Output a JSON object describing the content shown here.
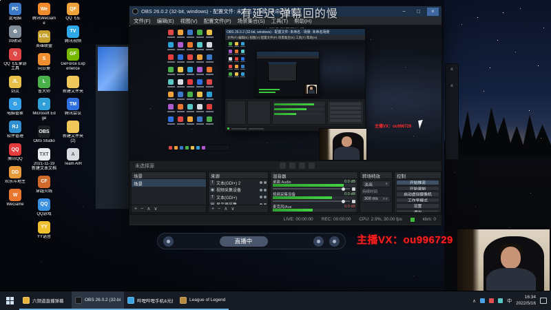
{
  "overlay": {
    "top_text": "有延迟 弹幕回的慢",
    "vx_text": "主播VX：ou996729",
    "pill_label": "直播中"
  },
  "desktop": {
    "columns": [
      [
        {
          "label": "此电脑",
          "glyph": "PC",
          "bg": "#3b78c8"
        },
        {
          "label": "回收站",
          "glyph": "♻",
          "bg": "#7f8c99"
        },
        {
          "label": "QQ飞车掌游工具",
          "glyph": "Q",
          "bg": "#e04848"
        },
        {
          "label": "剑灵",
          "glyph": "JL",
          "bg": "#e8c04a"
        },
        {
          "label": "电脑管家",
          "glyph": "G",
          "bg": "#35a0e8"
        },
        {
          "label": "软件管理",
          "glyph": "RJ",
          "bg": "#2f8fd0"
        },
        {
          "label": "腾讯QQ",
          "glyph": "QQ",
          "bg": "#e43c3c"
        },
        {
          "label": "欢乐斗地主",
          "glyph": "DD",
          "bg": "#e89a3a"
        },
        {
          "label": "WeGame",
          "glyph": "W",
          "bg": "#e8762e"
        }
      ],
      [
        {
          "label": "腾讯WeGame",
          "glyph": "We",
          "bg": "#f08a2a"
        },
        {
          "label": "英雄联盟",
          "glyph": "LOL",
          "bg": "#c8a02e"
        },
        {
          "label": "向日葵",
          "glyph": "S",
          "bg": "#ef8f2f"
        },
        {
          "label": "鲁大师",
          "glyph": "L",
          "bg": "#4ab04a"
        },
        {
          "label": "Microsoft Edge",
          "glyph": "e",
          "bg": "#2f9fd8"
        },
        {
          "label": "OBS Studio",
          "glyph": "OBS",
          "bg": "#1c1f24"
        },
        {
          "label": "2021-11-19 新建文本文档",
          "glyph": "TXT",
          "bg": "#e8ecef",
          "fg": "#555555"
        },
        {
          "label": "穿越火线",
          "glyph": "CF",
          "bg": "#d06a2a"
        },
        {
          "label": "QQ游戏",
          "glyph": "QQ",
          "bg": "#3a8fe0"
        },
        {
          "label": "YY语音",
          "glyph": "YY",
          "bg": "#f0c030"
        }
      ],
      [
        {
          "label": "QQ飞车",
          "glyph": "QF",
          "bg": "#f0a23a"
        },
        {
          "label": "腾讯视频",
          "glyph": "TV",
          "bg": "#2fa8e8"
        },
        {
          "label": "GeForce Experience",
          "glyph": "GF",
          "bg": "#76b900"
        },
        {
          "label": "新建文件夹",
          "glyph": "",
          "bg": "#f0c75a"
        },
        {
          "label": "腾讯会议",
          "glyph": "TM",
          "bg": "#2f6fe0"
        },
        {
          "label": "新建文件夹 (2)",
          "glyph": "",
          "bg": "#f0c75a"
        },
        {
          "label": "Team AIR",
          "glyph": "A",
          "bg": "#d8dce0",
          "fg": "#555555"
        }
      ]
    ]
  },
  "preview": {
    "palette": [
      "#e04848",
      "#f0a23a",
      "#3b78c8",
      "#4ab04a",
      "#e8c04a",
      "#2f9fd8",
      "#b05ad0",
      "#e8762e",
      "#58c8c8",
      "#d8dce0",
      "#e43c3c",
      "#2f6fe0"
    ]
  },
  "obs": {
    "title": "OBS 26.0.2 (32-bit, windows) - 配置文件: 未命名 - 场景: 未命名场景",
    "menus": [
      "文件(F)",
      "编辑(E)",
      "视图(V)",
      "配置文件(P)",
      "场景集合(S)",
      "工具(T)",
      "帮助(H)"
    ],
    "window_buttons": [
      "−",
      "□",
      "×"
    ],
    "toolbar": {
      "no_source": "未选择源"
    },
    "scenes": {
      "title": "场景",
      "items": [
        "场景"
      ],
      "foot": [
        "+",
        "−",
        "∧",
        "∨"
      ]
    },
    "sources": {
      "title": "来源",
      "items": [
        {
          "glyph": "T",
          "label": "文本(GDI+) 2"
        },
        {
          "glyph": "◉",
          "label": "视频采集设备"
        },
        {
          "glyph": "T",
          "label": "文本(GDI+)"
        },
        {
          "glyph": "▤",
          "label": "显示器采集"
        }
      ],
      "foot": [
        "+",
        "−",
        "∧",
        "∨"
      ]
    },
    "mixer": {
      "title": "混音器",
      "channels": [
        {
          "name": "桌面 Audio",
          "db": "0.0 dB",
          "level": 86,
          "muted": false
        },
        {
          "name": "视频采集设备",
          "db": "0.0 dB",
          "level": 72,
          "muted": false
        },
        {
          "name": "麦克风/Aux",
          "db": "0.0 dB",
          "level": 48,
          "muted": true
        }
      ]
    },
    "transitions": {
      "title": "转场特效",
      "selected": "淡出",
      "duration_label": "持续时间",
      "duration": "300 ms"
    },
    "controls": {
      "title": "控制",
      "buttons": [
        "开始推流",
        "开始录制",
        "启动虚拟摄像机",
        "工作室模式",
        "设置",
        "退出"
      ]
    },
    "status": {
      "live": "LIVE: 00:00:00",
      "rec": "REC: 00:00:00",
      "cpu": "CPU: 2.9%, 30.00 fps",
      "kbps": "kb/s: 0"
    }
  },
  "taskbar": {
    "apps": [
      {
        "label": "六频道直播弹幕",
        "bg": "#e8b33a",
        "active": false
      },
      {
        "label": "OBS 26.0.2 (32-bi...",
        "bg": "#16181c",
        "active": true
      },
      {
        "label": "哔哩哔哩手机&光摄像...",
        "bg": "#3aa3e0",
        "active": false
      },
      {
        "label": "League of Legends",
        "bg": "#b8893a",
        "active": false
      }
    ],
    "tray": {
      "lang": "中",
      "time": "16:34",
      "date": "2022/5/16"
    }
  }
}
